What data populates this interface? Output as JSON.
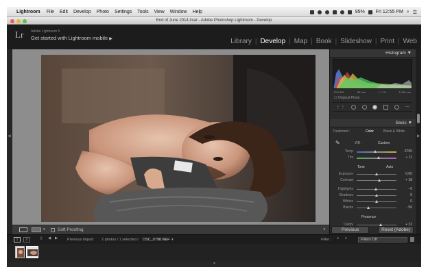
{
  "menubar": {
    "app": "Lightroom",
    "items": [
      "File",
      "Edit",
      "Develop",
      "Photo",
      "Settings",
      "Tools",
      "View",
      "Window",
      "Help"
    ],
    "battery": "95%",
    "clock": "Fri 12:55 PM"
  },
  "window": {
    "title": "End of June 2014.lrcat - Adobe Photoshop Lightroom - Develop"
  },
  "identity": {
    "logo": "Lr",
    "account": "Adobe Lightroom 5",
    "mobile": "Get started with Lightroom mobile"
  },
  "modules": [
    "Library",
    "Develop",
    "Map",
    "Book",
    "Slideshow",
    "Print",
    "Web"
  ],
  "toolbar": {
    "soft_proofing": "Soft Proofing"
  },
  "panel": {
    "histogram_title": "Histogram",
    "histo_info": [
      "ISO 800",
      "85 mm",
      "f / 1.8",
      "1/160 sec"
    ],
    "original_photo": "Original Photo",
    "basic_title": "Basic",
    "treatment_label": "Treatment :",
    "color": "Color",
    "bw": "Black & White",
    "wb_label": "WB :",
    "wb_value": "Custom",
    "temp_label": "Temp",
    "temp_value": "6750",
    "tint_label": "Tint",
    "tint_value": "+ 11",
    "tone_label": "Tone",
    "auto": "Auto",
    "exposure_label": "Exposure",
    "exposure_value": "0.00",
    "contrast_label": "Contrast",
    "contrast_value": "+ 18",
    "highlights_label": "Highlights",
    "highlights_value": "- 6",
    "shadows_label": "Shadows",
    "shadows_value": "0",
    "whites_label": "Whites",
    "whites_value": "0",
    "blacks_label": "Blacks",
    "blacks_value": "- 56",
    "presence_label": "Presence",
    "clarity_label": "Clarity",
    "clarity_value": "+ 22"
  },
  "buttons": {
    "previous": "Previous",
    "reset": "Reset (Adobe)"
  },
  "filmbar": {
    "page1": "1",
    "page2": "2",
    "source": "Previous Import",
    "count": "2 photos / 1 selected /",
    "filename": "DSC_0798.NEF",
    "filter_label": "Filter :",
    "filter_value": "Filters Off"
  },
  "colors": {
    "accent": "#ffffff",
    "background": "#262626",
    "panel": "#2b2b2b"
  }
}
